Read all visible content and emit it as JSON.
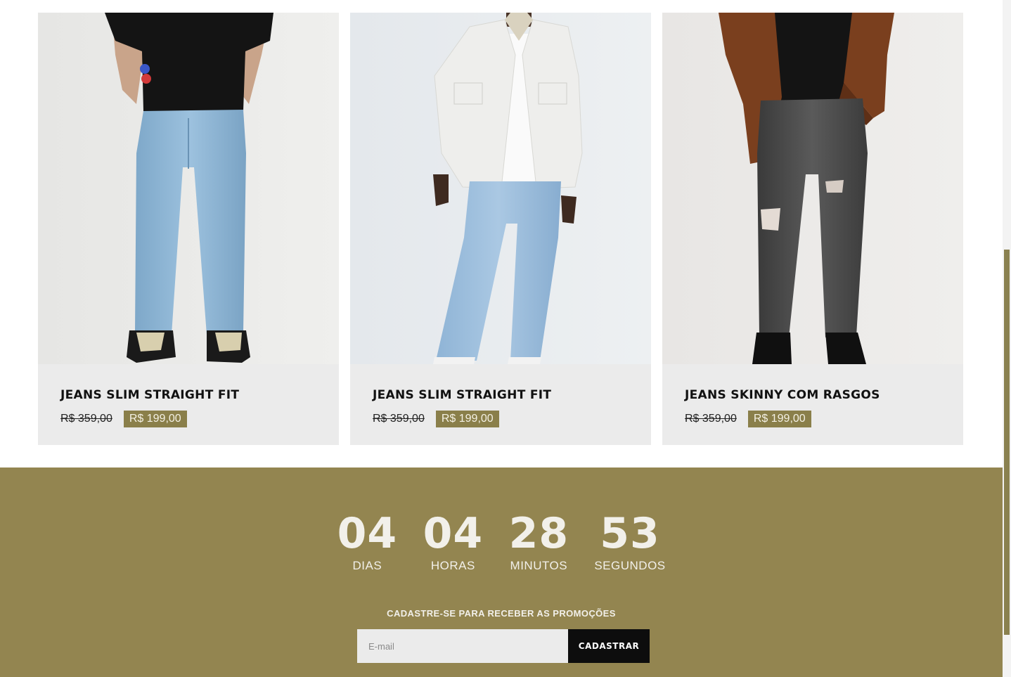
{
  "products": [
    {
      "title": "JEANS SLIM STRAIGHT FIT",
      "old_price": "R$ 359,00",
      "new_price": "R$ 199,00",
      "image_alt": "model-black-tee-light-jeans"
    },
    {
      "title": "JEANS SLIM STRAIGHT FIT",
      "old_price": "R$ 359,00",
      "new_price": "R$ 199,00",
      "image_alt": "model-white-jacket-light-jeans"
    },
    {
      "title": "JEANS SKINNY COM RASGOS",
      "old_price": "R$ 359,00",
      "new_price": "R$ 199,00",
      "image_alt": "model-brown-jacket-ripped-jeans"
    }
  ],
  "countdown": {
    "days": {
      "value": "04",
      "label": "DIAS"
    },
    "hours": {
      "value": "04",
      "label": "HORAS"
    },
    "minutes": {
      "value": "28",
      "label": "MINUTOS"
    },
    "seconds": {
      "value": "53",
      "label": "SEGUNDOS"
    }
  },
  "signup": {
    "title": "CADASTRE-SE PARA RECEBER AS PROMOÇÕES",
    "email_placeholder": "E-mail",
    "button_label": "CADASTRAR"
  },
  "colors": {
    "accent": "#938550",
    "price_badge": "#8a7f4a",
    "card_bg": "#ebebeb",
    "button_bg": "#0d0d0d"
  }
}
